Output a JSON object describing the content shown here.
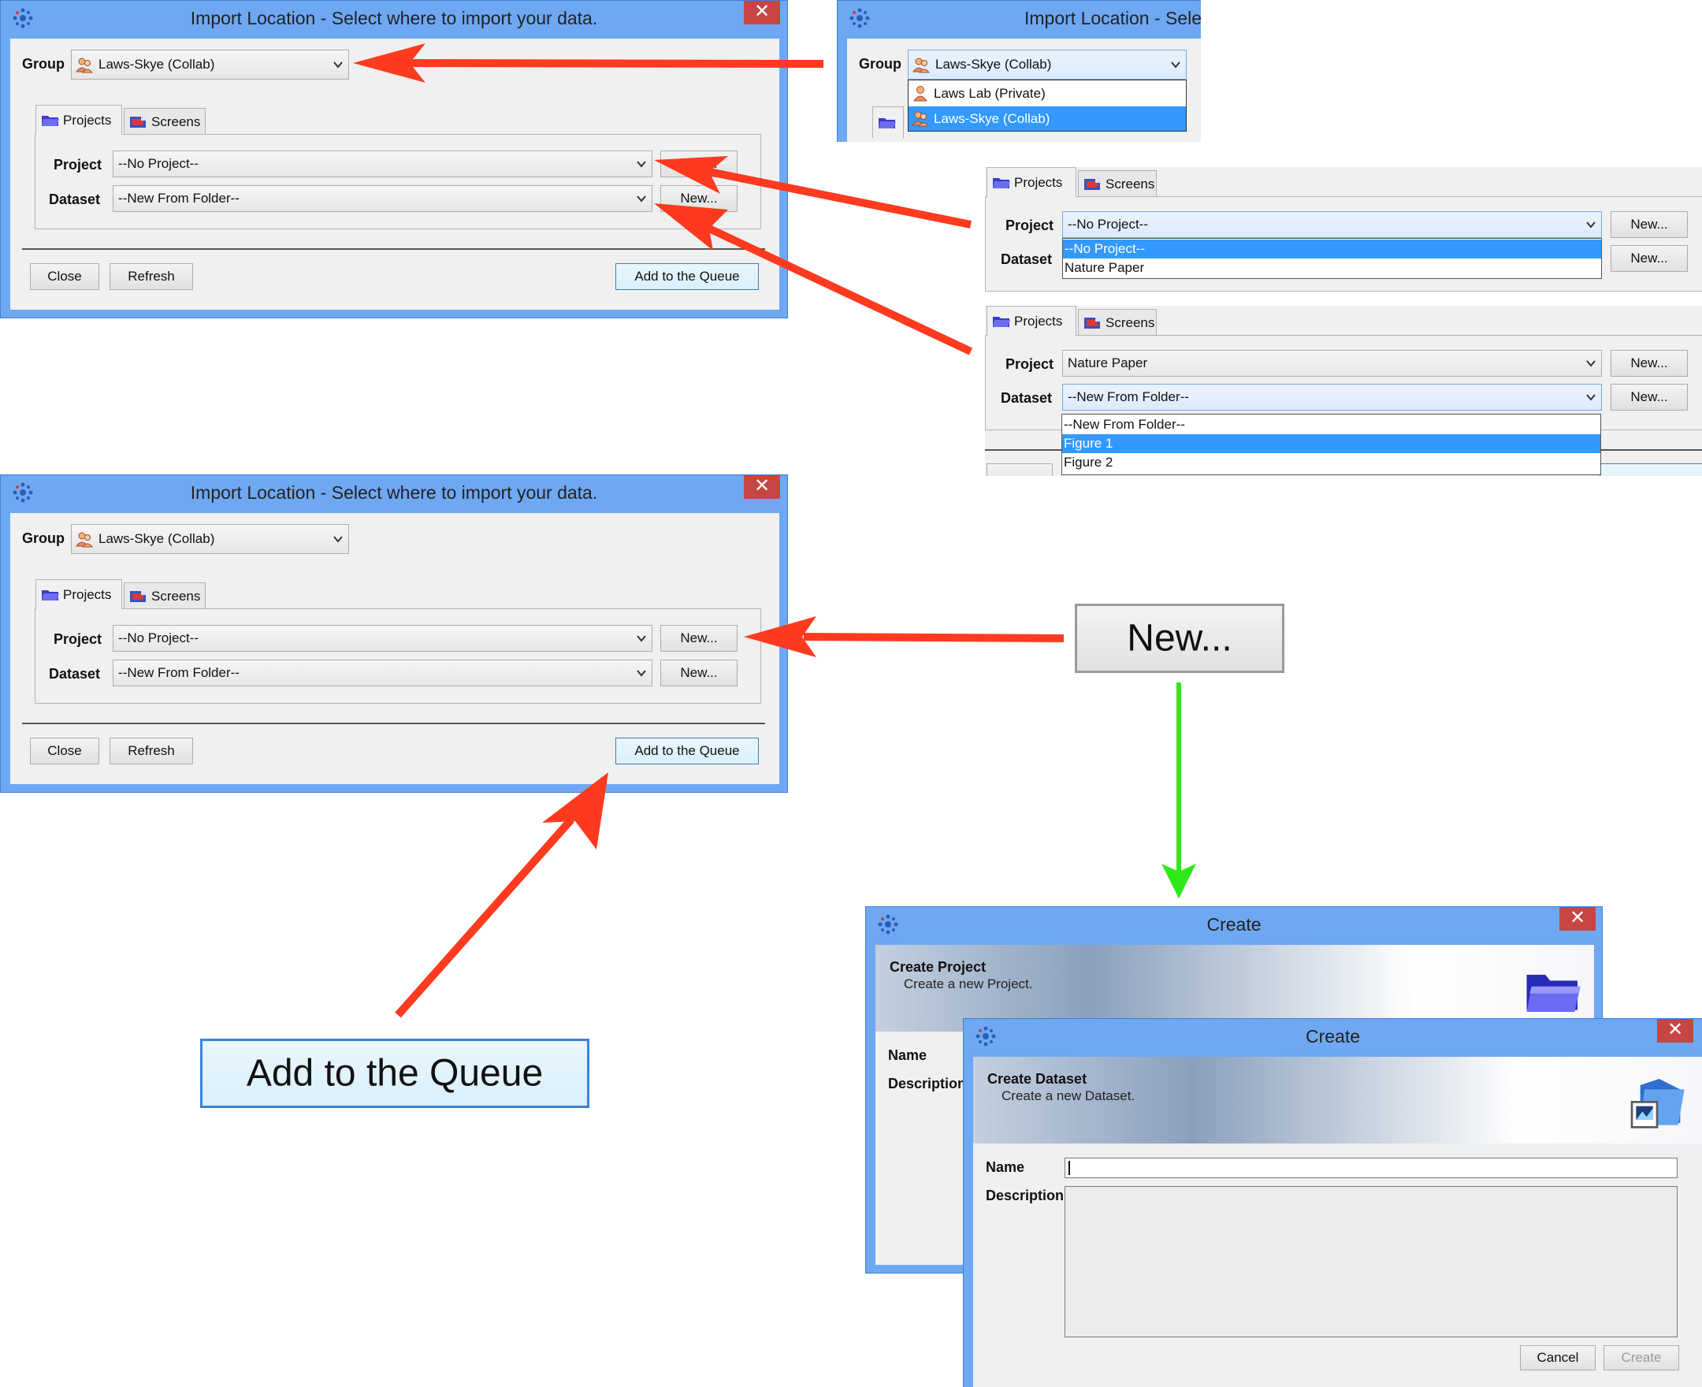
{
  "colors": {
    "window_frame": "#6ea8f3",
    "close_button": "#c74545",
    "selection": "#3399ff",
    "red_arrow": "#ff3a1e",
    "green_arrow": "#2ee81a"
  },
  "import_dialog": {
    "title": "Import Location - Select where to import your data.",
    "close_glyph": "✕",
    "group_label": "Group",
    "group_value": "Laws-Skye (Collab)",
    "tab_projects": "Projects",
    "tab_screens": "Screens",
    "project_label": "Project",
    "project_value": "--No Project--",
    "dataset_label": "Dataset",
    "dataset_value": "--New From Folder--",
    "new_button": "New...",
    "close_button": "Close",
    "refresh_button": "Refresh",
    "queue_button": "Add to the Queue"
  },
  "group_popup": {
    "title_partial": "Import Location - Sele",
    "options": [
      "Laws Lab (Private)",
      "Laws-Skye (Collab)"
    ],
    "selected_index": 1
  },
  "project_popup": {
    "options": [
      "--No Project--",
      "Nature Paper"
    ],
    "selected_index": 0
  },
  "dataset_popup": {
    "project_value": "Nature Paper",
    "options": [
      "--New From Folder--",
      "Figure 1",
      "Figure 2"
    ],
    "selected_index": 1
  },
  "zoom_new_label": "New...",
  "zoom_queue_label": "Add to the Queue",
  "create_project_dialog": {
    "title": "Create",
    "header": "Create Project",
    "subheader": "Create a new Project.",
    "name_label": "Name",
    "description_label": "Description"
  },
  "create_dataset_dialog": {
    "title": "Create",
    "header": "Create Dataset",
    "subheader": "Create a new Dataset.",
    "name_label": "Name",
    "description_label": "Description",
    "cancel_button": "Cancel",
    "create_button": "Create"
  },
  "icons": [
    "omero-app-icon",
    "group-icon",
    "user-icon",
    "folder-icon",
    "screen-icon",
    "dataset-icon",
    "chevron-down-icon",
    "close-icon"
  ]
}
